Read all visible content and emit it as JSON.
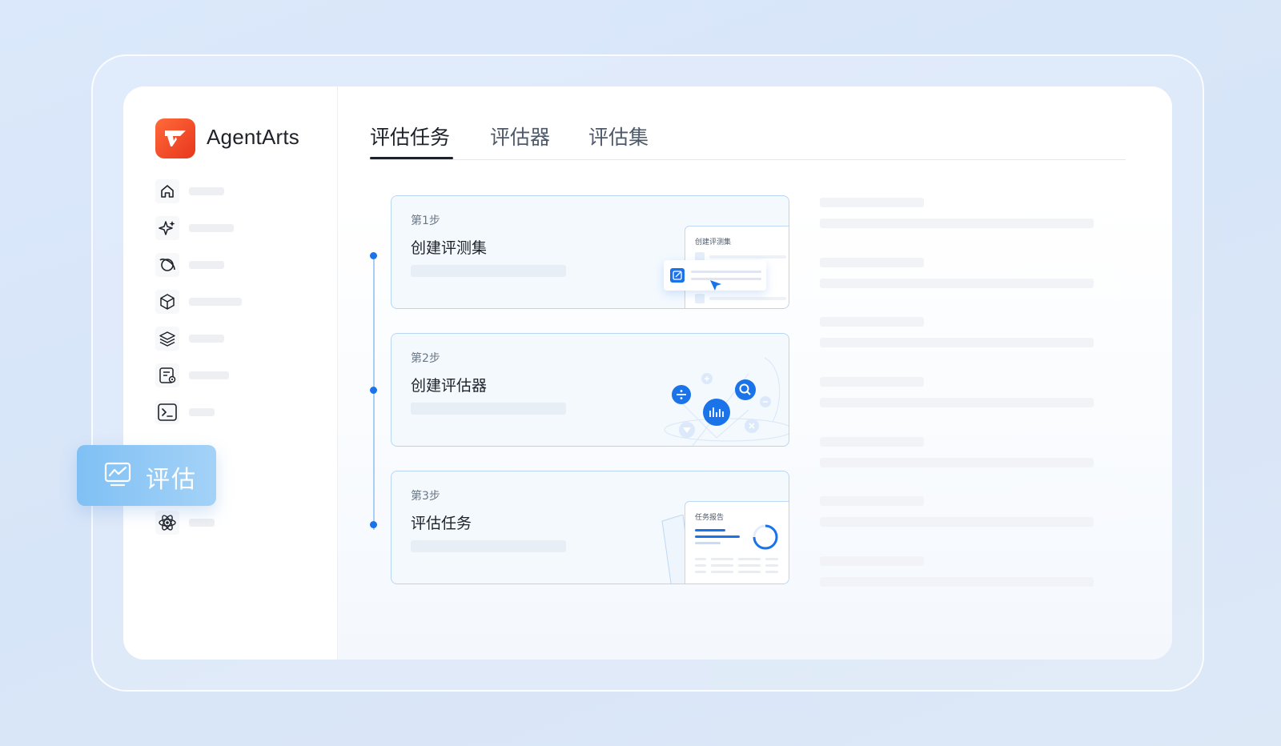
{
  "app": {
    "name": "AgentArts",
    "brand_color": "#f04a26",
    "accent_color": "#1a73e8"
  },
  "sidebar": {
    "items": [
      {
        "icon": "home-icon"
      },
      {
        "icon": "sparkle-icon"
      },
      {
        "icon": "planet-icon"
      },
      {
        "icon": "cube-icon"
      },
      {
        "icon": "layers-icon"
      },
      {
        "icon": "document-settings-icon"
      },
      {
        "icon": "terminal-icon"
      },
      {
        "icon": "monitor-chart-icon",
        "label": "评估",
        "active": true
      },
      {
        "icon": "atom-icon"
      }
    ]
  },
  "tabs": [
    {
      "label": "评估任务",
      "active": true
    },
    {
      "label": "评估器",
      "active": false
    },
    {
      "label": "评估集",
      "active": false
    }
  ],
  "steps": [
    {
      "step": "第1步",
      "title": "创建评测集",
      "illustration": {
        "panel_title": "创建评测集"
      }
    },
    {
      "step": "第2步",
      "title": "创建评估器",
      "illustration": {}
    },
    {
      "step": "第3步",
      "title": "评估任务",
      "illustration": {
        "panel_title": "任务报告"
      }
    }
  ]
}
